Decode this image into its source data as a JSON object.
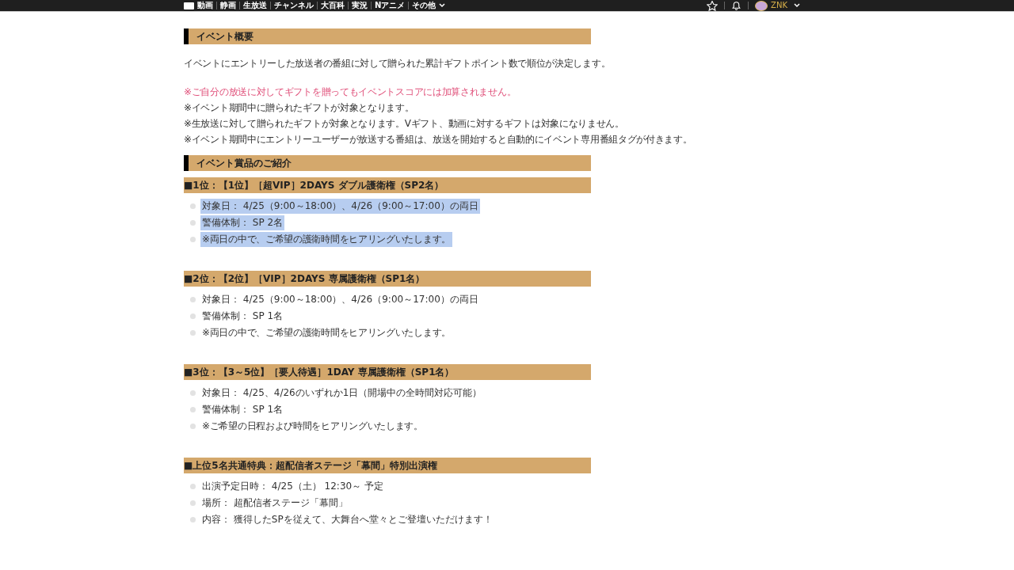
{
  "nav": {
    "items": [
      "動画",
      "静画",
      "生放送",
      "チャンネル",
      "大百科",
      "実況",
      "Nアニメ",
      "その他"
    ],
    "user": "ZNK"
  },
  "sections": [
    {
      "title": "イベント概要",
      "paragraphs": [
        {
          "text": "イベントにエントリーした放送者の番組に対して贈られた累計ギフトポイント数で順位が決定します。",
          "kind": "normal"
        },
        {
          "text": "※ご自分の放送に対してギフトを贈ってもイベントスコアには加算されません。",
          "kind": "warning"
        },
        {
          "text": "※イベント期間中に贈られたギフトが対象となります。",
          "kind": "normal"
        },
        {
          "text": "※生放送に対して贈られたギフトが対象となります。Vギフト、動画に対するギフトは対象になりません。",
          "kind": "normal"
        },
        {
          "text": "※イベント期間中にエントリーユーザーが放送する番組は、放送を開始すると自動的にイベント専用番組タグが付きます。",
          "kind": "normal"
        }
      ]
    },
    {
      "title": "イベント賞品のご紹介"
    }
  ],
  "prizes": [
    {
      "title": "■1位：【1位】［超VIP］2DAYS ダブル護衛権（SP2名）",
      "items": [
        {
          "text": "対象日： 4/25（9:00～18:00）、4/26（9:00～17:00）の両日",
          "kind": "normal",
          "selected": true
        },
        {
          "text": "警備体制： SP 2名",
          "kind": "normal",
          "selected": true
        },
        {
          "text": "※両日の中で、ご希望の護衛時間をヒアリングいたします。",
          "kind": "note",
          "selected": true
        }
      ]
    },
    {
      "title": "■2位：【2位】［VIP］2DAYS 専属護衛権（SP1名）",
      "items": [
        {
          "text": "対象日： 4/25（9:00～18:00）、4/26（9:00～17:00）の両日",
          "kind": "normal",
          "selected": false
        },
        {
          "text": "警備体制： SP 1名",
          "kind": "normal",
          "selected": false
        },
        {
          "text": "※両日の中で、ご希望の護衛時間をヒアリングいたします。",
          "kind": "note",
          "selected": false
        }
      ]
    },
    {
      "title": "■3位：【3～5位】［要人待遇］1DAY 専属護衛権（SP1名）",
      "items": [
        {
          "text": "対象日： 4/25、4/26のいずれか1日（開場中の全時間対応可能）",
          "kind": "normal",
          "selected": false
        },
        {
          "text": "警備体制： SP 1名",
          "kind": "normal",
          "selected": false
        },
        {
          "text": "※ご希望の日程および時間をヒアリングいたします。",
          "kind": "note",
          "selected": false
        }
      ]
    },
    {
      "title": "■上位5名共通特典：超配信者ステージ「幕間」特別出演権",
      "items": [
        {
          "text": "出演予定日時： 4/25（土） 12:30～ 予定",
          "kind": "normal",
          "selected": false
        },
        {
          "text": "場所： 超配信者ステージ「幕間」",
          "kind": "normal",
          "selected": false
        },
        {
          "text": "内容： 獲得したSPを従えて、大舞台へ堂々とご登壇いただけます！",
          "kind": "normal",
          "selected": false
        }
      ]
    }
  ]
}
